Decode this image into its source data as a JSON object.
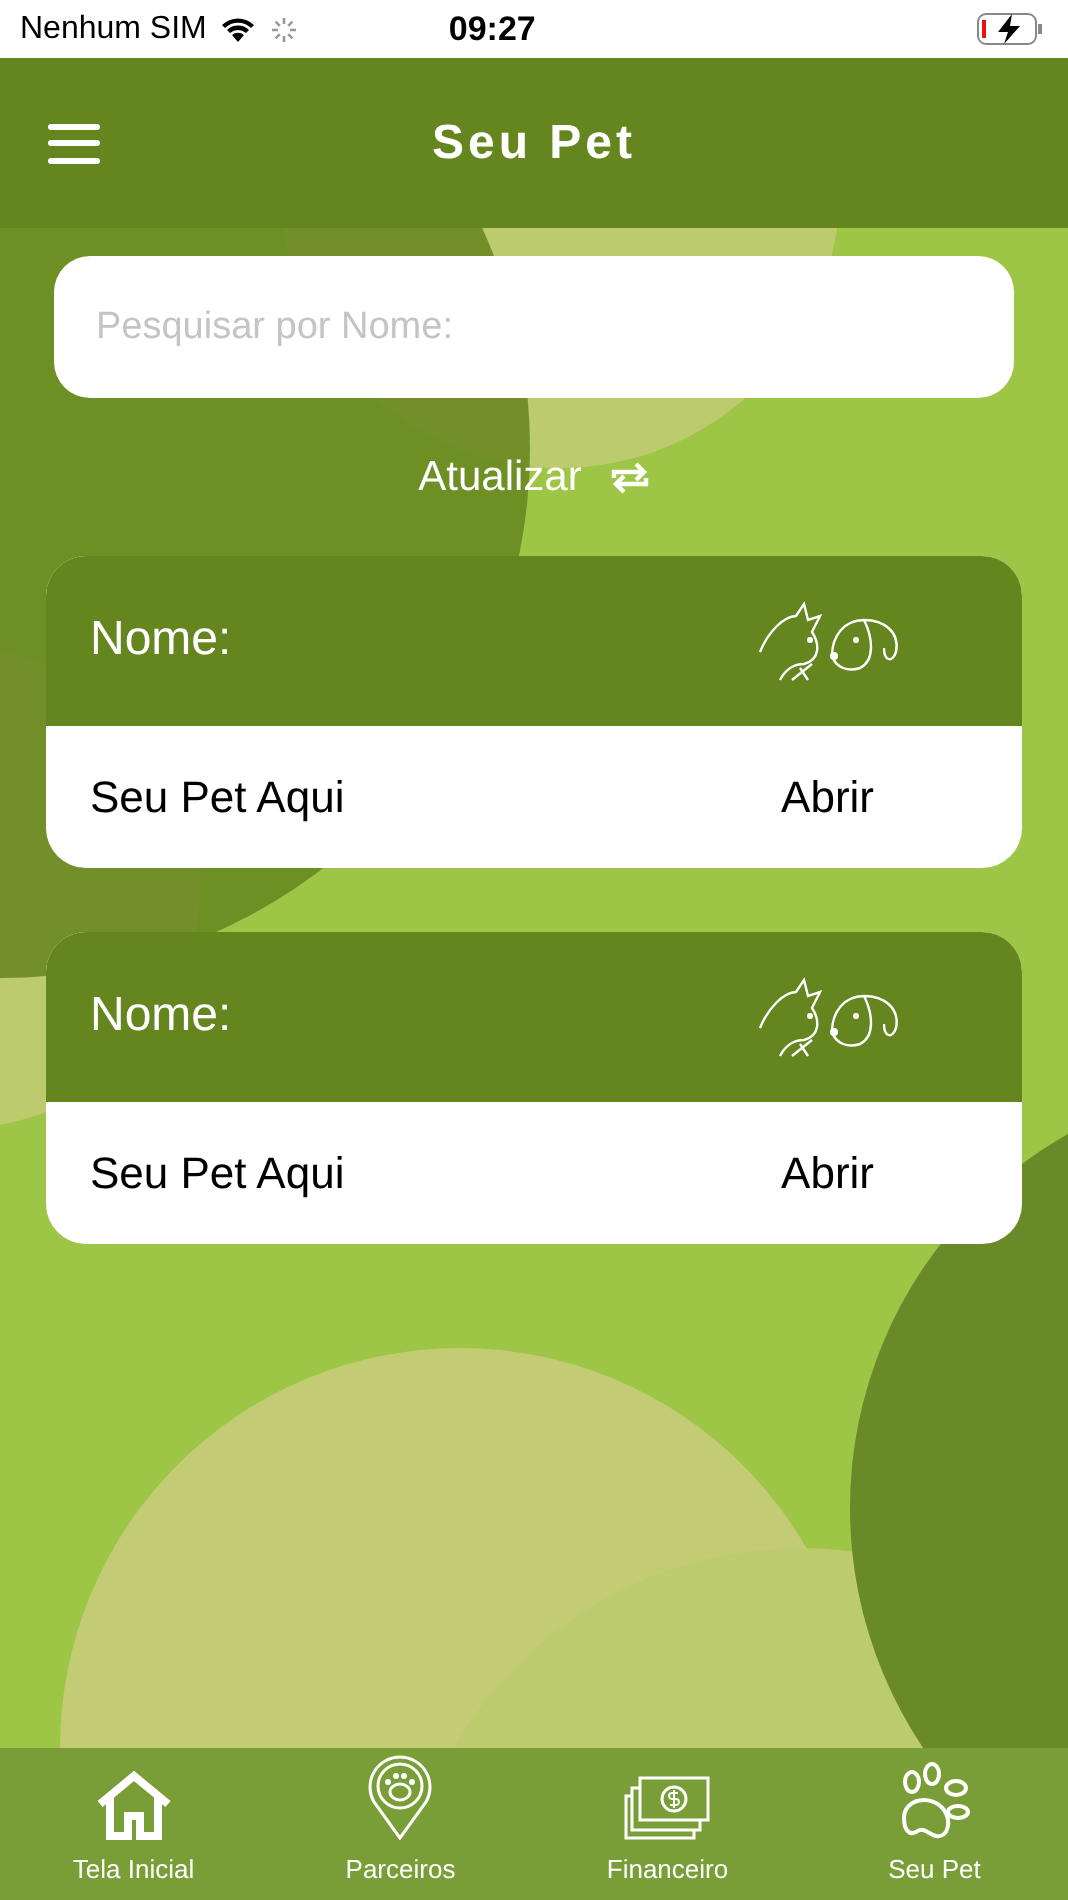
{
  "status_bar": {
    "carrier": "Nenhum SIM",
    "time": "09:27"
  },
  "header": {
    "title": "Seu Pet"
  },
  "search": {
    "placeholder": "Pesquisar por Nome:"
  },
  "refresh": {
    "label": "Atualizar"
  },
  "pets": [
    {
      "label": "Nome:",
      "name": "Seu Pet Aqui",
      "action": "Abrir"
    },
    {
      "label": "Nome:",
      "name": "Seu Pet Aqui",
      "action": "Abrir"
    }
  ],
  "tab_bar": [
    {
      "kind": "home",
      "label": "Tela Inicial"
    },
    {
      "kind": "partners",
      "label": "Parceiros"
    },
    {
      "kind": "finance",
      "label": "Financeiro"
    },
    {
      "kind": "pet",
      "label": "Seu Pet"
    }
  ]
}
